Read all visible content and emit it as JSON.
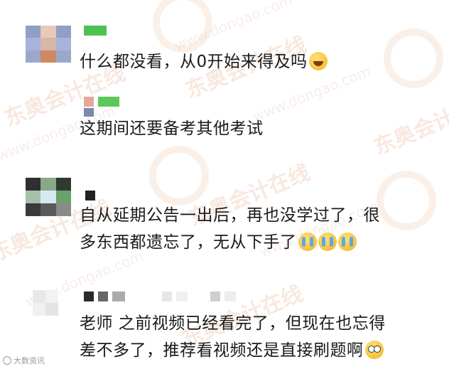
{
  "watermark": {
    "brand": "东奥会计在线",
    "url": "www.dongao.com"
  },
  "footer": {
    "mark": "大数资讯"
  },
  "comments": [
    {
      "text": "什么都没看，从0开始来得及吗",
      "emoji": "laugh"
    },
    {
      "text": "这期间还要备考其他考试",
      "emoji": ""
    },
    {
      "text_line1": "自从延期公告一出后，再也没学过了，很",
      "text_line2": "多东西都遗忘了，无从下手了",
      "emoji": "cry"
    },
    {
      "text_line1": "老师 之前视频已经看完了，但现在也忘得",
      "text_line2": "差不多了，推荐看视频还是直接刷题啊",
      "emoji": "flush"
    }
  ]
}
